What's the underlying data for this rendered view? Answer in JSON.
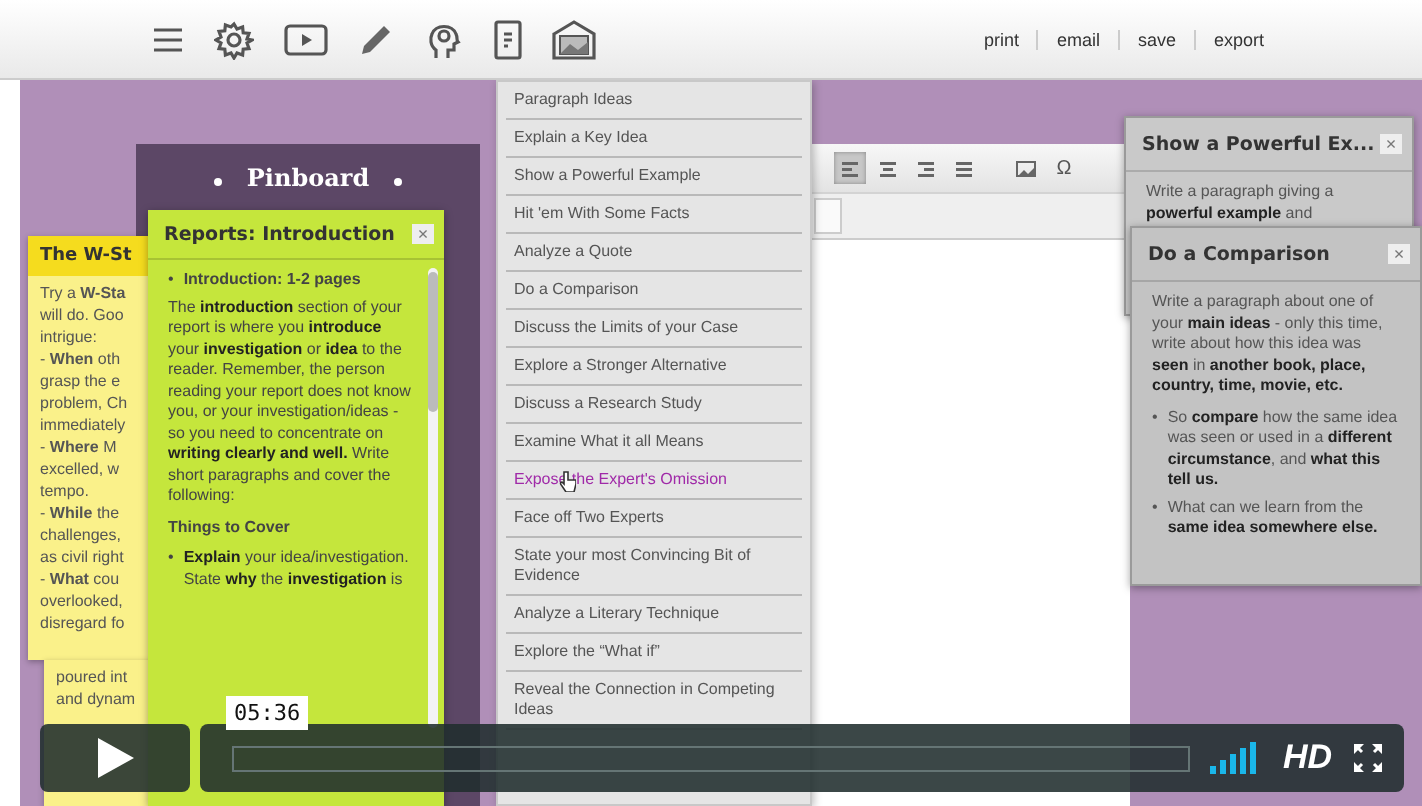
{
  "toolbar": {
    "links": [
      "print",
      "email",
      "save",
      "export"
    ]
  },
  "pinboard": {
    "title": "Pinboard"
  },
  "fragment_notes": [
    {
      "title": "The W-St",
      "color": "#f5dc1e",
      "lines": [
        "Try a **W-Sta**",
        "will do. Goo",
        "intrigue:",
        "- **When** oth",
        "grasp the e",
        "problem, Ch",
        "immediately",
        "- **Where** M",
        "excelled, w",
        "tempo.",
        "- **While** the",
        "challenges,",
        "as civil right",
        "- **What** cou",
        "overlooked,",
        "disregard fo"
      ]
    },
    {
      "color": "#faf18a",
      "lines": [
        "poured int",
        "and dynam"
      ]
    }
  ],
  "report_note": {
    "title": "Reports: Introduction",
    "close": "×",
    "color": "#c5e63c",
    "blocks": [
      {
        "kind": "bullet",
        "marker": "•",
        "bold": true,
        "text": "Introduction: 1-2 pages"
      },
      {
        "kind": "para",
        "bold": false,
        "text": "The **introduction** section of your report is where you **introduce** your **investigation** or **idea** to the reader. Remember, the person reading your report does not know you, or your investigation/ideas - so you need to concentrate on **writing clearly and well.** Write short paragraphs and cover the following:"
      },
      {
        "kind": "para",
        "bold": true,
        "text": "Things to Cover"
      },
      {
        "kind": "bullet",
        "marker": "•",
        "bold": false,
        "text": "**Explain** your idea/investigation. State **why** the **investigation** is"
      }
    ]
  },
  "menu": {
    "items": [
      {
        "label": "Paragraph Ideas",
        "selected": false
      },
      {
        "label": "Explain a Key Idea",
        "selected": false
      },
      {
        "label": "Show a Powerful Example",
        "selected": false
      },
      {
        "label": "Hit 'em With Some Facts",
        "selected": false
      },
      {
        "label": "Analyze a Quote",
        "selected": false
      },
      {
        "label": "Do a Comparison",
        "selected": false
      },
      {
        "label": "Discuss the Limits of your Case",
        "selected": false
      },
      {
        "label": "Explore a Stronger Alternative",
        "selected": false
      },
      {
        "label": "Discuss a Research Study",
        "selected": false
      },
      {
        "label": "Examine What it all Means",
        "selected": false
      },
      {
        "label": "Expose the Expert's Omission",
        "selected": true
      },
      {
        "label": "Face off Two Experts",
        "selected": false
      },
      {
        "label": "State your most Convincing Bit of Evidence",
        "selected": false
      },
      {
        "label": "Analyze a Literary Technique",
        "selected": false
      },
      {
        "label": "Explore the “What if”",
        "selected": false
      },
      {
        "label": "Reveal the Connection in Competing Ideas",
        "selected": false
      }
    ]
  },
  "editor": {
    "tools": [
      {
        "kind": "align-left",
        "selected": true
      },
      {
        "kind": "align-center",
        "selected": false
      },
      {
        "kind": "align-right",
        "selected": false
      },
      {
        "kind": "justify",
        "selected": false
      },
      {
        "kind": "image",
        "selected": false
      },
      {
        "kind": "symbol",
        "label": "Ω",
        "selected": false
      }
    ]
  },
  "side_notes": [
    {
      "title": "Show a Powerful Ex...",
      "close": "×",
      "color": "#c9c9c9",
      "blocks": [
        {
          "kind": "para",
          "bold": false,
          "text": "Write a paragraph giving a **powerful example** and"
        }
      ]
    },
    {
      "title": "Do a Comparison",
      "close": "×",
      "color": "#c3c3c3",
      "blocks": [
        {
          "kind": "para",
          "bold": false,
          "text": "Write a paragraph about one of your **main ideas** - only this time, write about how this idea was **seen** in **another book, place, country, time, movie, etc.**"
        },
        {
          "kind": "bullet",
          "marker": "•",
          "bold": false,
          "text": "So **compare** how the same idea was seen or used in a **different circumstance**, and **what this tell us.**"
        },
        {
          "kind": "bullet",
          "marker": "•",
          "bold": false,
          "text": "What can we learn from the **same idea somewhere else.**"
        }
      ]
    }
  ],
  "player": {
    "time": "05:36",
    "quality": "HD"
  }
}
